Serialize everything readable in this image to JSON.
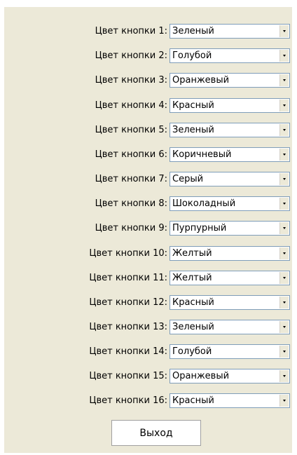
{
  "rows": [
    {
      "label": "Цвет кнопки 1:",
      "value": "Зеленый"
    },
    {
      "label": "Цвет кнопки 2:",
      "value": "Голубой"
    },
    {
      "label": "Цвет кнопки 3:",
      "value": "Оранжевый"
    },
    {
      "label": "Цвет кнопки 4:",
      "value": "Красный"
    },
    {
      "label": "Цвет кнопки 5:",
      "value": "Зеленый"
    },
    {
      "label": "Цвет кнопки 6:",
      "value": "Коричневый"
    },
    {
      "label": "Цвет кнопки 7:",
      "value": "Серый"
    },
    {
      "label": "Цвет кнопки 8:",
      "value": "Шоколадный"
    },
    {
      "label": "Цвет кнопки 9:",
      "value": "Пурпурный"
    },
    {
      "label": "Цвет кнопки 10:",
      "value": "Желтый"
    },
    {
      "label": "Цвет кнопки 11:",
      "value": "Желтый"
    },
    {
      "label": "Цвет кнопки 12:",
      "value": "Красный"
    },
    {
      "label": "Цвет кнопки 13:",
      "value": "Зеленый"
    },
    {
      "label": "Цвет кнопки 14:",
      "value": "Голубой"
    },
    {
      "label": "Цвет кнопки 15:",
      "value": "Оранжевый"
    },
    {
      "label": "Цвет кнопки 16:",
      "value": "Красный"
    }
  ],
  "exit_label": "Выход"
}
